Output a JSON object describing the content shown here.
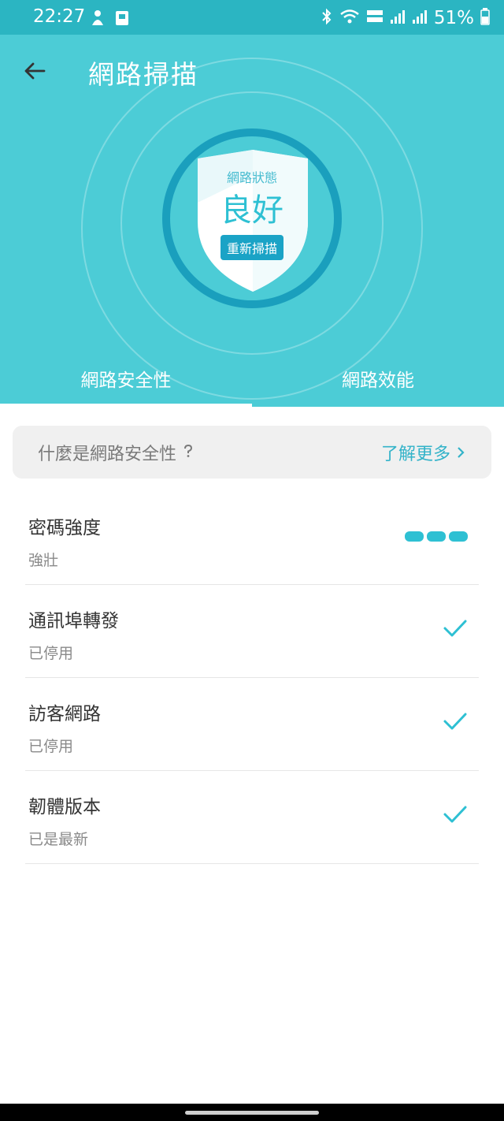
{
  "status_bar": {
    "time": "22:27",
    "battery": "51%"
  },
  "header": {
    "title": "網路掃描",
    "shield": {
      "label": "網路狀態",
      "value": "良好",
      "rescan": "重新掃描"
    },
    "tabs": [
      {
        "label": "網路安全性",
        "active": true
      },
      {
        "label": "網路效能",
        "active": false
      }
    ]
  },
  "info": {
    "question": "什麼是網路安全性",
    "learn_more": "了解更多"
  },
  "items": [
    {
      "title": "密碼強度",
      "status": "強壯",
      "indicator": "strength-bars",
      "strength": 3
    },
    {
      "title": "通訊埠轉發",
      "status": "已停用",
      "indicator": "checkmark-icon"
    },
    {
      "title": "訪客網路",
      "status": "已停用",
      "indicator": "checkmark-icon"
    },
    {
      "title": "韌體版本",
      "status": "已是最新",
      "indicator": "checkmark-icon"
    }
  ],
  "colors": {
    "header_bg": "#4cccd6",
    "status_bg": "#2bb5c2",
    "accent": "#2ec0d3",
    "ring": "#1a9fbd"
  }
}
